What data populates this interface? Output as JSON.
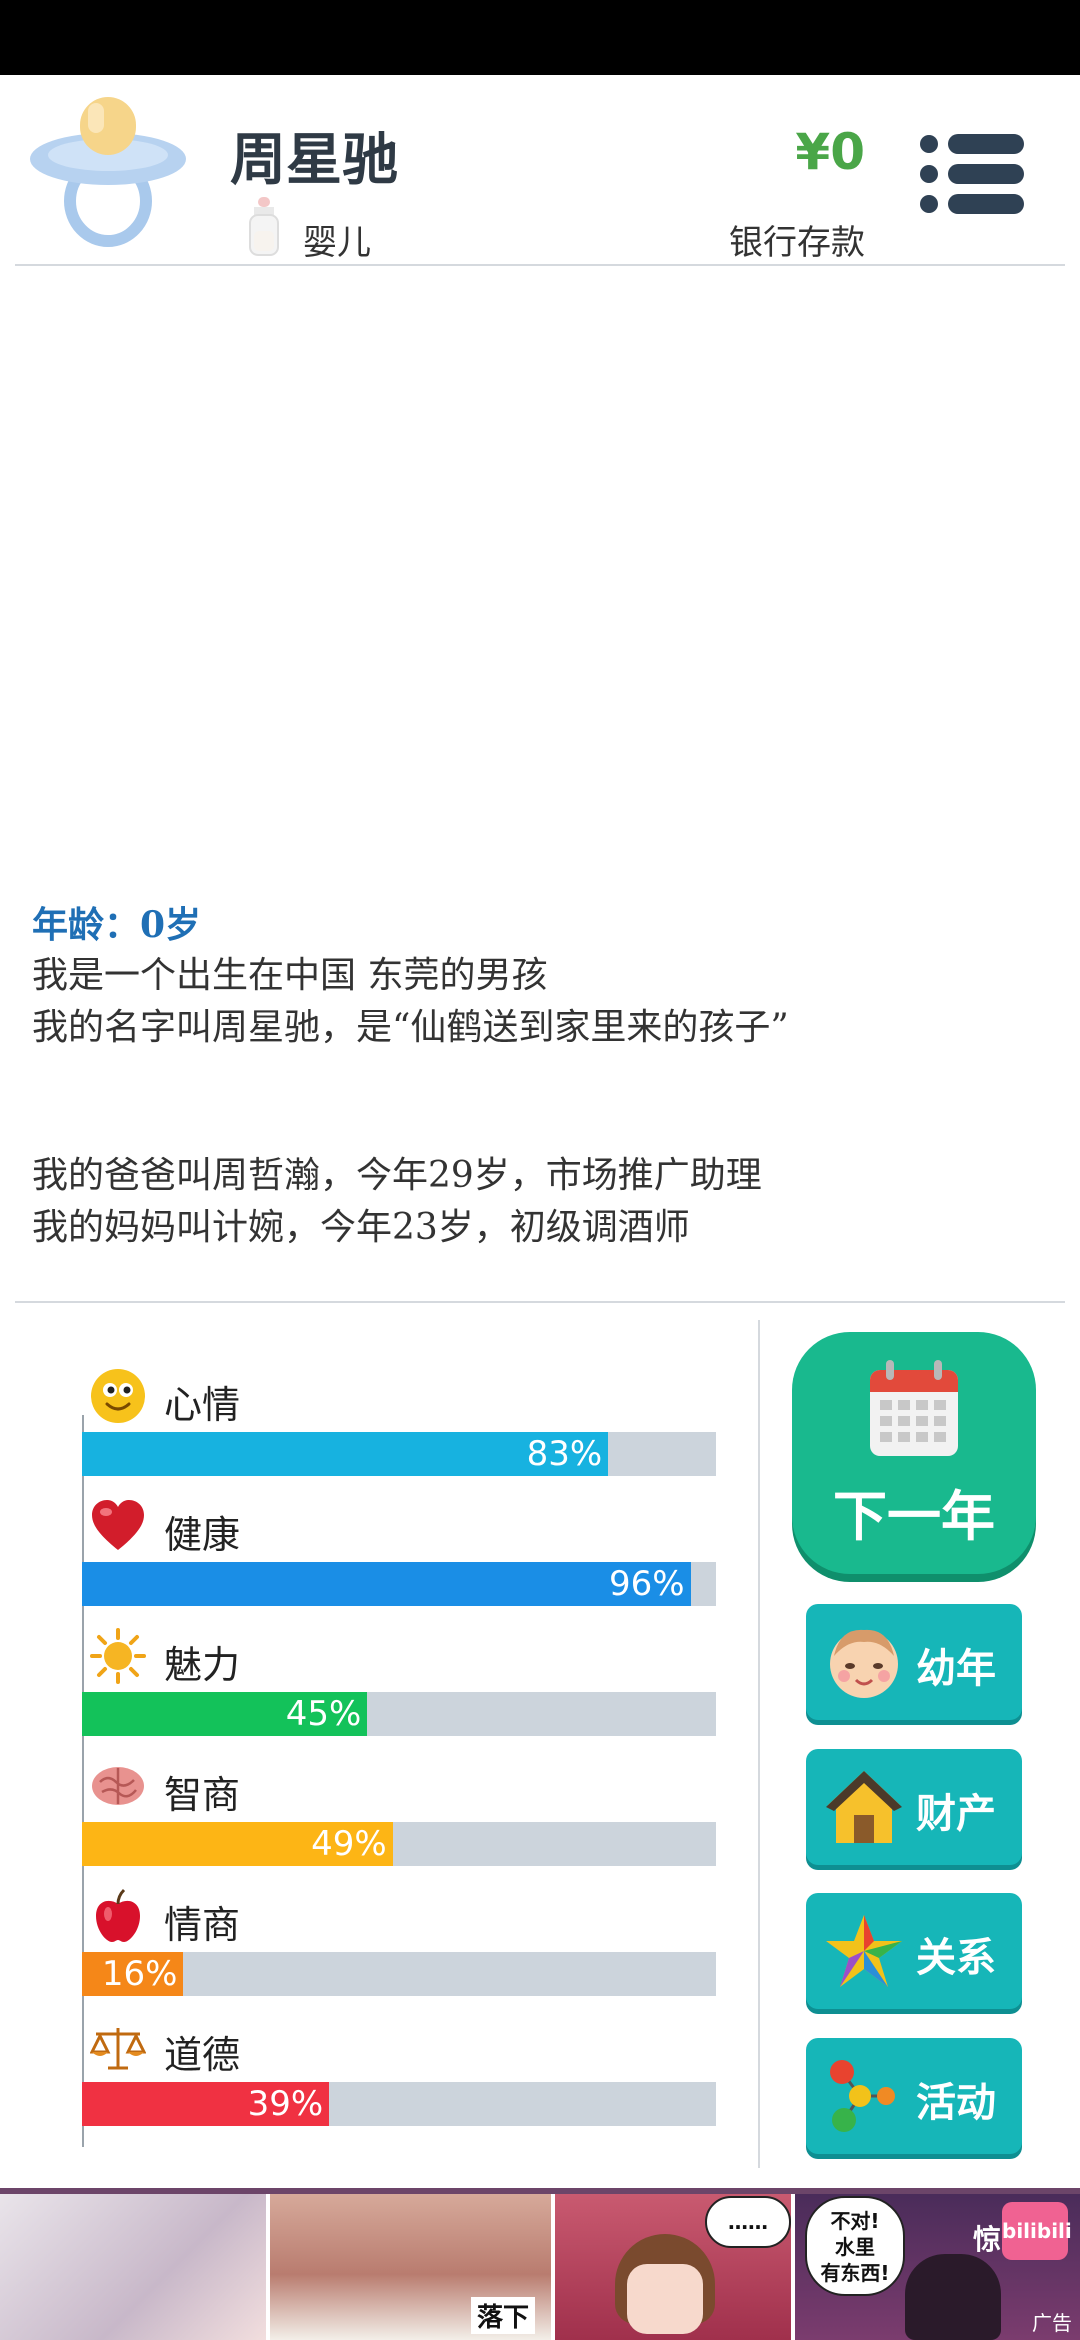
{
  "header": {
    "name": "周星驰",
    "stage": "婴儿",
    "money": "¥0",
    "money_label": "银行存款"
  },
  "story": {
    "age_label": "年龄：0岁",
    "lines1": [
      "我是一个出生在中国 东莞的男孩",
      "我的名字叫周星驰，是“仙鹤送到家里来的孩子”"
    ],
    "lines2": [
      "我的爸爸叫周哲瀚，今年29岁，市场推广助理",
      "我的妈妈叫计婉，今年23岁，初级调酒师"
    ]
  },
  "stats": [
    {
      "label": "心情",
      "value": 83,
      "text": "83%",
      "color": "#17b2e0",
      "icon": "smiley-icon"
    },
    {
      "label": "健康",
      "value": 96,
      "text": "96%",
      "color": "#1a8ee6",
      "icon": "heart-icon"
    },
    {
      "label": "魅力",
      "value": 45,
      "text": "45%",
      "color": "#13c25a",
      "icon": "sun-icon"
    },
    {
      "label": "智商",
      "value": 49,
      "text": "49%",
      "color": "#fdb515",
      "icon": "brain-icon"
    },
    {
      "label": "情商",
      "value": 16,
      "text": "16%",
      "color": "#f58718",
      "icon": "apple-icon"
    },
    {
      "label": "道德",
      "value": 39,
      "text": "39%",
      "color": "#f03142",
      "icon": "scales-icon"
    }
  ],
  "actions": {
    "next_year": "下一年",
    "buttons": [
      {
        "label": "幼年",
        "icon": "baby-face-icon"
      },
      {
        "label": "财产",
        "icon": "house-icon"
      },
      {
        "label": "关系",
        "icon": "star-icon"
      },
      {
        "label": "活动",
        "icon": "molecule-icon"
      }
    ]
  },
  "ad": {
    "bubble_dots": "……",
    "bubble_text_1": "不对!",
    "bubble_text_2": "水里",
    "bubble_text_3": "有东西!",
    "side_text": "惊",
    "caption": "落下",
    "badge": "bilibili",
    "label": "广告"
  },
  "colors": {
    "money": "#4aa648",
    "age": "#1f6fb5",
    "next_button": "#19b98e",
    "side_button": "#16b6b8"
  }
}
